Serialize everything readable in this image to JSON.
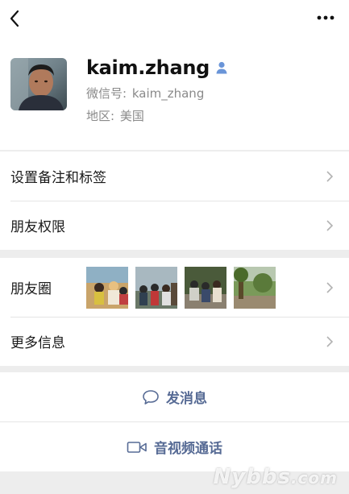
{
  "profile": {
    "name": "kaim.zhang",
    "wechat_id_label": "微信号:",
    "wechat_id": "kaim_zhang",
    "region_label": "地区:",
    "region": "美国",
    "gender_icon": "male-person-icon"
  },
  "menu": {
    "remarks_tags": "设置备注和标签",
    "friend_permissions": "朋友权限",
    "moments": "朋友圈",
    "more_info": "更多信息"
  },
  "actions": {
    "send_message": "发消息",
    "video_call": "音视频通话"
  },
  "watermark": {
    "brand": "Nybbs",
    "suffix": ".com"
  },
  "colors": {
    "link": "#576b95",
    "gender": "#6a95d8",
    "background": "#ededed"
  }
}
